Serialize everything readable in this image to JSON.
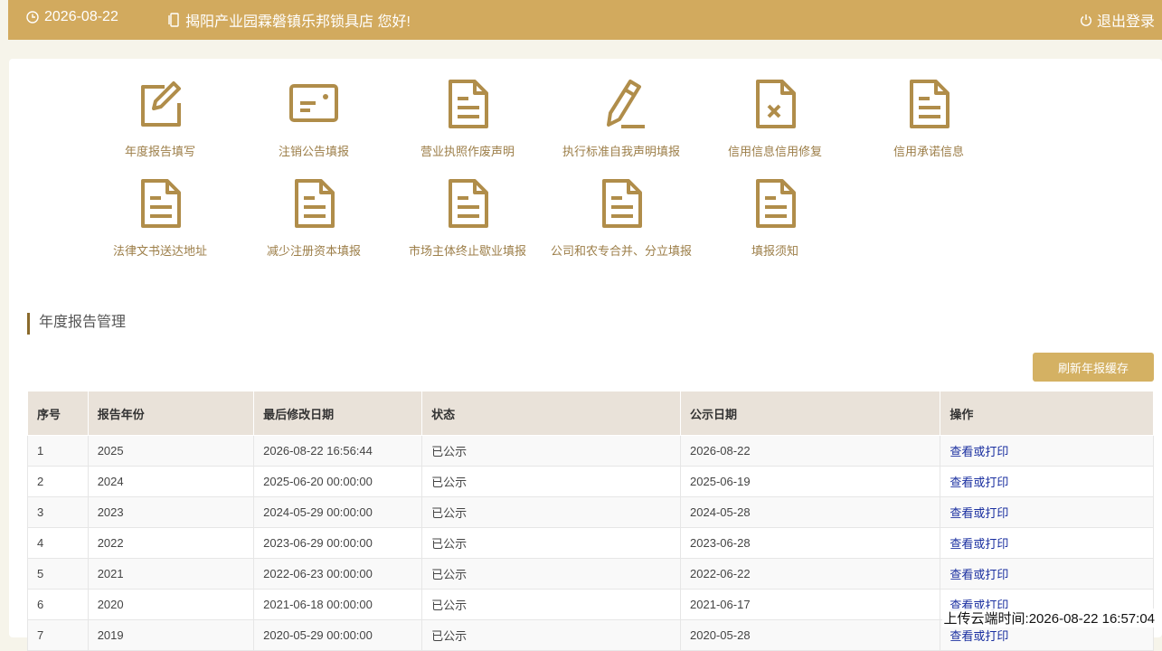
{
  "topbar": {
    "date": "2026-08-22",
    "greeting": "揭阳产业园霖磐镇乐邦锁具店 您好!",
    "logout": "退出登录"
  },
  "menu": [
    {
      "label": "年度报告填写",
      "icon": "edit-icon"
    },
    {
      "label": "注销公告填报",
      "icon": "card-icon"
    },
    {
      "label": "营业执照作废声明",
      "icon": "document-icon"
    },
    {
      "label": "执行标准自我声明填报",
      "icon": "pencil-icon"
    },
    {
      "label": "信用信息信用修复",
      "icon": "document-x-icon"
    },
    {
      "label": "信用承诺信息",
      "icon": "document-icon"
    },
    {
      "label": "法律文书送达地址",
      "icon": "document-icon"
    },
    {
      "label": "减少注册资本填报",
      "icon": "document-icon"
    },
    {
      "label": "市场主体终止歇业填报",
      "icon": "document-icon"
    },
    {
      "label": "公司和农专合并、分立填报",
      "icon": "document-icon"
    },
    {
      "label": "填报须知",
      "icon": "document-icon"
    }
  ],
  "section": {
    "title": "年度报告管理",
    "refresh": "刷新年报缓存"
  },
  "table": {
    "headers": [
      "序号",
      "报告年份",
      "最后修改日期",
      "状态",
      "公示日期",
      "操作"
    ],
    "rows": [
      [
        "1",
        "2025",
        "2026-08-22 16:56:44",
        "已公示",
        "2026-08-22",
        "查看或打印"
      ],
      [
        "2",
        "2024",
        "2025-06-20 00:00:00",
        "已公示",
        "2025-06-19",
        "查看或打印"
      ],
      [
        "3",
        "2023",
        "2024-05-29 00:00:00",
        "已公示",
        "2024-05-28",
        "查看或打印"
      ],
      [
        "4",
        "2022",
        "2023-06-29 00:00:00",
        "已公示",
        "2023-06-28",
        "查看或打印"
      ],
      [
        "5",
        "2021",
        "2022-06-23 00:00:00",
        "已公示",
        "2022-06-22",
        "查看或打印"
      ],
      [
        "6",
        "2020",
        "2021-06-18 00:00:00",
        "已公示",
        "2021-06-17",
        "查看或打印"
      ],
      [
        "7",
        "2019",
        "2020-05-29 00:00:00",
        "已公示",
        "2020-05-28",
        "查看或打印"
      ]
    ]
  },
  "footer": {
    "upload_time": "上传云端时间:2026-08-22 16:57:04"
  },
  "colors": {
    "topbar": "#d2aa5e",
    "icon": "#b08d4a",
    "button": "#d4b163",
    "link": "#1a2fa0"
  }
}
